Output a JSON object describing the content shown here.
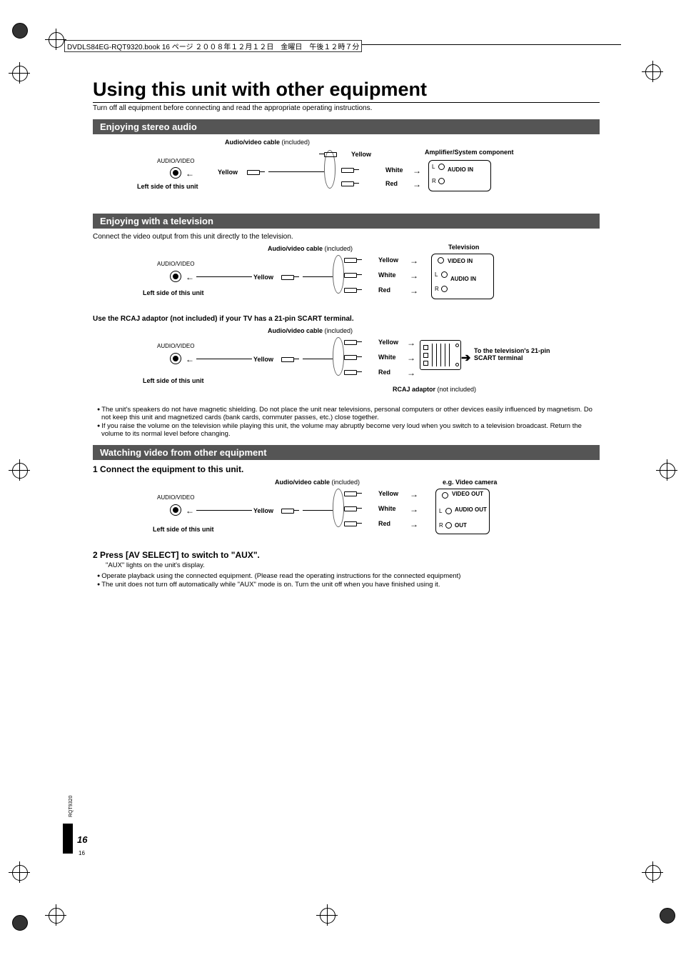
{
  "header": {
    "book_ref": "DVDLS84EG-RQT9320.book  16 ページ  ２００８年１２月１２日　金曜日　午後１２時７分"
  },
  "title": "Using this unit with other equipment",
  "subtitle": "Turn off all equipment before connecting and read the appropriate operating instructions.",
  "sections": {
    "stereo": {
      "heading": "Enjoying stereo audio",
      "cable_label_bold": "Audio/video cable",
      "cable_label_rest": " (included)",
      "unit_port_label": "AUDIO/VIDEO",
      "unit_side_label": "Left side of this unit",
      "plug_yellow": "Yellow",
      "plug_white": "White",
      "plug_red": "Red",
      "dest_title": "Amplifier/System component",
      "dest_L": "L",
      "dest_R": "R",
      "dest_audio_in": "AUDIO IN"
    },
    "tv": {
      "heading": "Enjoying with a television",
      "intro": "Connect the video output from this unit directly to the television.",
      "cable_label_bold": "Audio/video cable",
      "cable_label_rest": " (included)",
      "unit_port_label": "AUDIO/VIDEO",
      "unit_side_label": "Left side of this unit",
      "plug_yellow": "Yellow",
      "plug_white": "White",
      "plug_red": "Red",
      "dest_title": "Television",
      "dest_video_in": "VIDEO IN",
      "dest_L": "L",
      "dest_R": "R",
      "dest_audio_in": "AUDIO IN",
      "scart_note": "Use the RCAJ adaptor (not included) if your TV has a 21-pin SCART terminal.",
      "scart_cable_bold": "Audio/video cable",
      "scart_cable_rest": " (included)",
      "scart_dest": "To the television's 21-pin SCART terminal",
      "rcaj_bold": "RCAJ adaptor",
      "rcaj_rest": " (not included)",
      "bullets": [
        "The unit's speakers do not have magnetic shielding. Do not place the unit near televisions, personal computers or other devices easily influenced by magnetism. Do not keep this unit and magnetized cards (bank cards, commuter passes, etc.) close together.",
        "If you raise the volume on the television while playing this unit, the volume may abruptly become very loud when you switch to a television broadcast. Return the volume to its normal level before changing."
      ]
    },
    "aux": {
      "heading": "Watching video from other equipment",
      "step1": "1   Connect the equipment to this unit.",
      "cable_label_bold": "Audio/video cable",
      "cable_label_rest": " (included)",
      "unit_port_label": "AUDIO/VIDEO",
      "unit_side_label": "Left side of this unit",
      "plug_yellow": "Yellow",
      "plug_white": "White",
      "plug_red": "Red",
      "dest_title": "e.g. Video camera",
      "dest_video_out": "VIDEO OUT",
      "dest_L": "L",
      "dest_R": "R",
      "dest_audio_out": "AUDIO OUT",
      "dest_out": "OUT",
      "step2": "2   Press [AV SELECT] to switch to \"AUX\".",
      "step2_sub": "\"AUX\" lights on the unit's display.",
      "bullets": [
        "Operate playback using the connected equipment. (Please read the operating instructions for the connected equipment)",
        "The unit does not turn off automatically while \"AUX\" mode is on. Turn the unit off when you have finished using it."
      ]
    }
  },
  "footer": {
    "doc_id": "RQT9320",
    "page_italic": "16",
    "page_small": "16"
  }
}
